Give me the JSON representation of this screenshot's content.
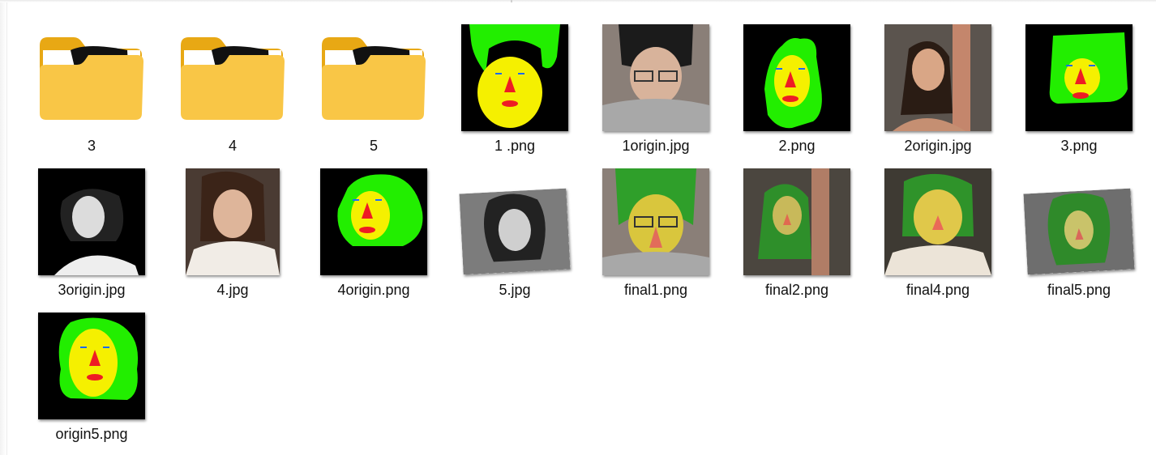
{
  "window": {
    "view": "large-icons"
  },
  "files": [
    {
      "name": "3",
      "kind": "folder",
      "thumb": "folder-bw-portrait"
    },
    {
      "name": "4",
      "kind": "folder",
      "thumb": "folder-bw-portrait"
    },
    {
      "name": "5",
      "kind": "folder",
      "thumb": "folder-bw-portrait"
    },
    {
      "name": "1 .png",
      "kind": "image",
      "thumb": "face-mask"
    },
    {
      "name": "1origin.jpg",
      "kind": "image",
      "thumb": "photo-man-glasses"
    },
    {
      "name": "2.png",
      "kind": "image",
      "thumb": "face-mask"
    },
    {
      "name": "2origin.jpg",
      "kind": "image",
      "thumb": "photo-woman-arm"
    },
    {
      "name": "3.png",
      "kind": "image",
      "thumb": "face-mask"
    },
    {
      "name": "3origin.jpg",
      "kind": "image",
      "thumb": "photo-bw-woman"
    },
    {
      "name": "4.jpg",
      "kind": "image",
      "thumb": "photo-woman-white"
    },
    {
      "name": "4origin.png",
      "kind": "image",
      "thumb": "face-mask"
    },
    {
      "name": "5.jpg",
      "kind": "image",
      "thumb": "photo-bw-man-tilted"
    },
    {
      "name": "final1.png",
      "kind": "image",
      "thumb": "blend-man-glasses"
    },
    {
      "name": "final2.png",
      "kind": "image",
      "thumb": "blend-woman-arm"
    },
    {
      "name": "final4.png",
      "kind": "image",
      "thumb": "blend-woman-white"
    },
    {
      "name": "final5.png",
      "kind": "image",
      "thumb": "blend-man-tilted"
    },
    {
      "name": "origin5.png",
      "kind": "image",
      "thumb": "face-mask"
    }
  ],
  "colors": {
    "mask_bg": "#000000",
    "hair": "#22ee00",
    "face": "#f5f000",
    "nose": "#ee1c24",
    "folder": "#f9c646"
  }
}
